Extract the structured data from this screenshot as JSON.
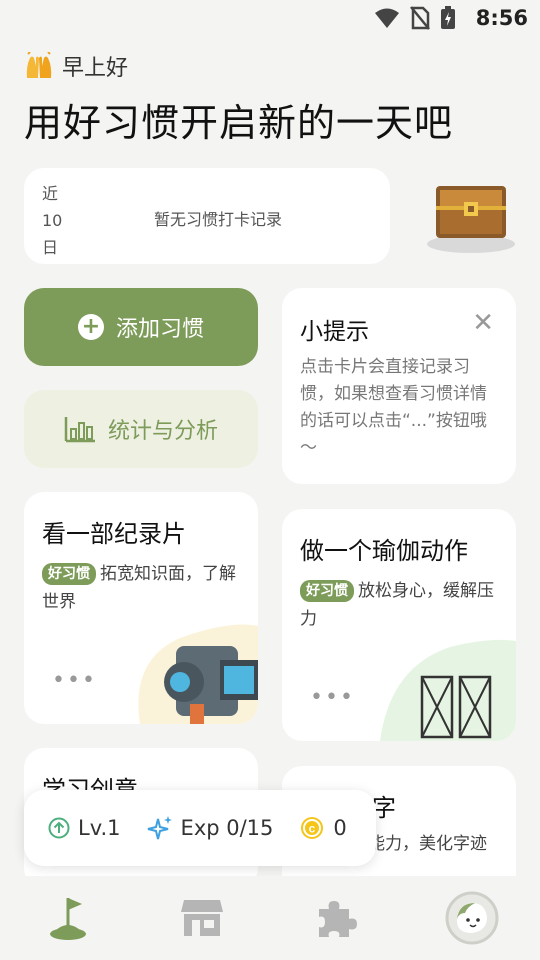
{
  "status": {
    "time": "8:56"
  },
  "header": {
    "greeting": "早上好",
    "title": "用好习惯开启新的一天吧"
  },
  "recent": {
    "label": "近10日",
    "empty_text": "暂无习惯打卡记录"
  },
  "actions": {
    "add_label": "添加习惯",
    "stats_label": "统计与分析"
  },
  "tips": {
    "title": "小提示",
    "body": "点击卡片会直接记录习惯，如果想查看习惯详情的话可以点击“...”按钮哦～"
  },
  "habits": [
    {
      "title": "看一部纪录片",
      "badge": "好习惯",
      "desc": "拓宽知识面，了解世界"
    },
    {
      "title": "做一个瑜伽动作",
      "badge": "好习惯",
      "desc": "放松身心，缓解压力"
    },
    {
      "title": "学习创意",
      "desc": ""
    },
    {
      "title": "练手写字",
      "desc": "提高书写能力，美化字迹"
    }
  ],
  "stats": {
    "level": "Lv.1",
    "exp": "Exp 0/15",
    "coins": "0"
  },
  "colors": {
    "accent": "#7d9b59",
    "accent_light": "#eef0e2"
  },
  "icons": {
    "more": "•••"
  }
}
